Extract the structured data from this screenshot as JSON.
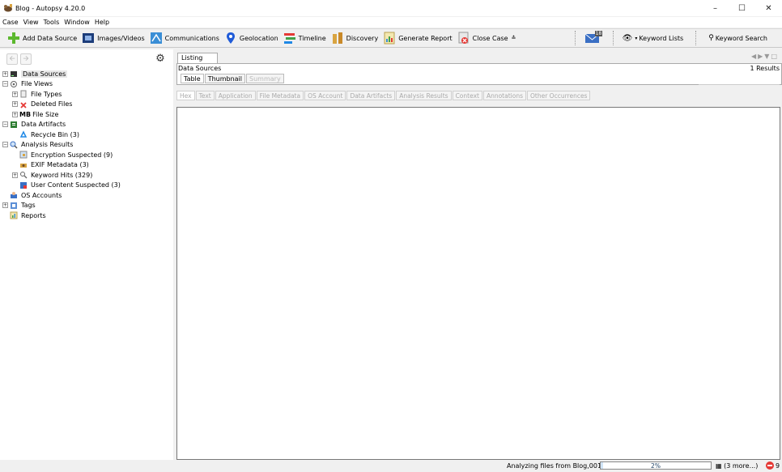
{
  "window": {
    "title": "Blog - Autopsy 4.20.0"
  },
  "menu": [
    "Case",
    "View",
    "Tools",
    "Window",
    "Help"
  ],
  "toolbar": {
    "add_data_source": "Add Data Source",
    "images_videos": "Images/Videos",
    "communications": "Communications",
    "geolocation": "Geolocation",
    "timeline": "Timeline",
    "discovery": "Discovery",
    "generate_report": "Generate Report",
    "close_case": "Close Case",
    "inbox_badge": "18",
    "keyword_lists": "Keyword Lists",
    "keyword_search": "Keyword Search"
  },
  "tree": {
    "data_sources": "Data Sources",
    "file_views": "File Views",
    "file_types": "File Types",
    "deleted_files": "Deleted Files",
    "file_size": "File Size",
    "file_size_icon": "MB",
    "data_artifacts": "Data Artifacts",
    "recycle_bin": "Recycle Bin (3)",
    "analysis_results": "Analysis Results",
    "encryption_suspected": "Encryption Suspected (9)",
    "exif_metadata": "EXIF Metadata (3)",
    "keyword_hits": "Keyword Hits (329)",
    "user_content_suspected": "User Content Suspected (3)",
    "os_accounts": "OS Accounts",
    "tags": "Tags",
    "reports": "Reports"
  },
  "listing": {
    "tab": "Listing",
    "header": "Data Sources",
    "results": "1  Results",
    "view_tabs": [
      "Table",
      "Thumbnail",
      "Summary"
    ]
  },
  "content_tabs": [
    "Hex",
    "Text",
    "Application",
    "File Metadata",
    "OS Account",
    "Data Artifacts",
    "Analysis Results",
    "Context",
    "Annotations",
    "Other Occurrences"
  ],
  "status": {
    "text": "Analyzing files from Blog,001",
    "progress_label": "2%",
    "progress_value": 0.02,
    "more": "(3 more...)",
    "error_count": "9"
  }
}
